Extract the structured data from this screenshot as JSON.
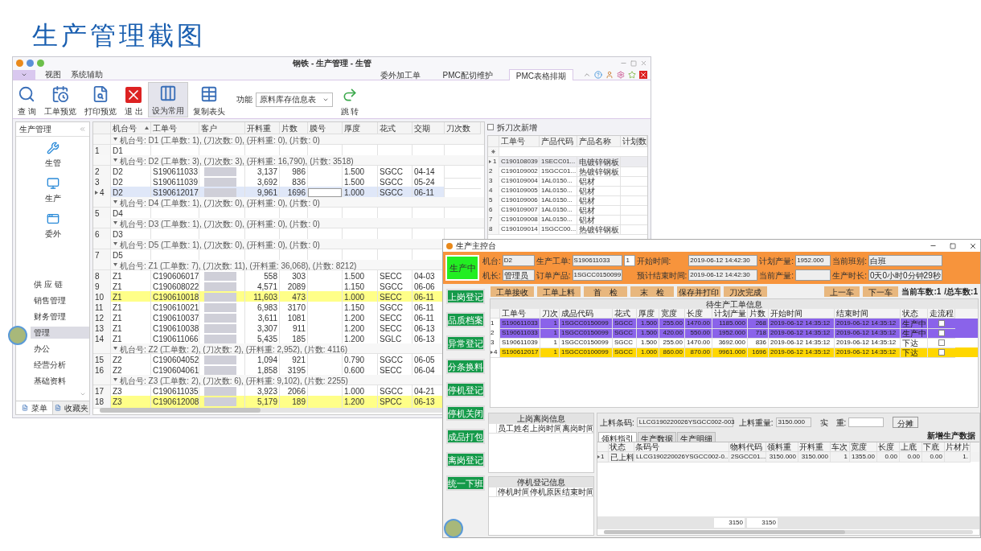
{
  "slide_title": "生产管理截图",
  "back_window": {
    "title": "钢铁 - 生产管理 - 生管",
    "menu": [
      "视图",
      "系统辅助"
    ],
    "ribbon_tabs": [
      {
        "label": "委外加工单",
        "selected": false
      },
      {
        "label": "PMC配切维护",
        "selected": false
      },
      {
        "label": "PMC表格排期",
        "selected": true
      }
    ],
    "toolbar": [
      {
        "label": "查 询",
        "selected": false
      },
      {
        "label": "工单预览",
        "selected": false
      },
      {
        "label": "打印预览",
        "selected": false
      },
      {
        "label": "退 出",
        "selected": false
      },
      {
        "label": "设为常用",
        "selected": true
      },
      {
        "label": "复制表头",
        "selected": false
      }
    ],
    "function_select": {
      "label": "功能",
      "value": "原料库存信息表"
    },
    "jump_button": "跳 转",
    "sidebar": {
      "title": "生产管理",
      "modules": [
        {
          "label": "生管"
        },
        {
          "label": "生产"
        },
        {
          "label": "委外"
        }
      ],
      "items": [
        {
          "label": "供 应 链",
          "selected": false
        },
        {
          "label": "销售管理",
          "selected": false
        },
        {
          "label": "财务管理",
          "selected": false
        },
        {
          "label": "管理",
          "selected": true
        },
        {
          "label": "办公",
          "selected": false
        },
        {
          "label": "经营分析",
          "selected": false
        },
        {
          "label": "基础资料",
          "selected": false
        }
      ],
      "tabs": [
        {
          "label": "菜单",
          "selected": true
        },
        {
          "label": "收藏夹",
          "selected": false
        }
      ]
    },
    "grid": {
      "columns": [
        "机台号",
        "工单号",
        "客户",
        "开料重",
        "片数",
        "膜号",
        "厚度",
        "花式",
        "交期",
        "刀次数"
      ],
      "rows": [
        {
          "kind": "group",
          "expanded": true,
          "text": "机台号: D1 (工单数: 1), (刀次数: 0), (开料重: 0), (片数: 0)"
        },
        {
          "kind": "row",
          "no": "1",
          "machine": "D1",
          "selected": false,
          "color": "#ffffff"
        },
        {
          "kind": "group",
          "expanded": true,
          "text": "机台号: D2 (工单数: 3), (刀次数: 3), (开料重: 16,790), (片数: 3518)"
        },
        {
          "kind": "row",
          "no": "2",
          "machine": "D2",
          "order": "S190611033",
          "customer_hidden": true,
          "weight": "3,137",
          "pieces": "986",
          "thickness": "1.500",
          "pattern": "SGCC",
          "due": "04-14",
          "selected": false,
          "color": "#ffffff"
        },
        {
          "kind": "row",
          "no": "3",
          "machine": "D2",
          "order": "S190611039",
          "customer_hidden": true,
          "weight": "3,692",
          "pieces": "836",
          "thickness": "1.500",
          "pattern": "SGCC",
          "due": "05-24",
          "selected": false,
          "color": "#ffffff"
        },
        {
          "kind": "row",
          "no": "4",
          "machine": "D2",
          "order": "S190612017",
          "customer_hidden": true,
          "weight": "9,961",
          "pieces": "1696",
          "thickness": "1.000",
          "pattern": "SGCC",
          "due": "06-11",
          "selected": true
        },
        {
          "kind": "group",
          "expanded": true,
          "text": "机台号: D4 (工单数: 1), (刀次数: 0), (开料重: 0), (片数: 0)"
        },
        {
          "kind": "row",
          "no": "5",
          "machine": "D4",
          "selected": false,
          "color": "#ffffff"
        },
        {
          "kind": "group",
          "expanded": true,
          "text": "机台号: D3 (工单数: 1), (刀次数: 0), (开料重: 0), (片数: 0)"
        },
        {
          "kind": "row",
          "no": "6",
          "machine": "D3",
          "selected": false,
          "color": "#ffffff"
        },
        {
          "kind": "group",
          "expanded": true,
          "text": "机台号: D5 (工单数: 1), (刀次数: 0), (开料重: 0), (片数: 0)"
        },
        {
          "kind": "row",
          "no": "7",
          "machine": "D5",
          "selected": false,
          "color": "#ffffff"
        },
        {
          "kind": "group",
          "expanded": true,
          "text": "机台号: Z1 (工单数: 7), (刀次数: 11), (开料重: 36,068), (片数: 8212)"
        },
        {
          "kind": "row",
          "no": "8",
          "machine": "Z1",
          "order": "C190606017",
          "customer_hidden": true,
          "weight": "558",
          "pieces": "303",
          "thickness": "1.500",
          "pattern": "SECC",
          "due": "04-03",
          "selected": false,
          "color": "#ffffff"
        },
        {
          "kind": "row",
          "no": "9",
          "machine": "Z1",
          "order": "C190608022",
          "customer_hidden": true,
          "weight": "4,571",
          "pieces": "2089",
          "thickness": "1.150",
          "pattern": "SGCC",
          "due": "06-06",
          "selected": false,
          "color": "#ffffff"
        },
        {
          "kind": "row",
          "no": "10",
          "machine": "Z1",
          "order": "C190610018",
          "customer_hidden": true,
          "weight": "11,603",
          "pieces": "473",
          "thickness": "1.000",
          "pattern": "SECC",
          "due": "06-11",
          "selected": false,
          "color": "#ffff88"
        },
        {
          "kind": "row",
          "no": "11",
          "machine": "Z1",
          "order": "C190610021",
          "customer_hidden": true,
          "weight": "6,983",
          "pieces": "3170",
          "thickness": "1.150",
          "pattern": "SGCC",
          "due": "06-11",
          "selected": false,
          "color": "#ffffff"
        },
        {
          "kind": "row",
          "no": "12",
          "machine": "Z1",
          "order": "C190610037",
          "customer_hidden": true,
          "weight": "3,611",
          "pieces": "1081",
          "thickness": "1.200",
          "pattern": "SECC",
          "due": "06-11",
          "selected": false,
          "color": "#ffffff"
        },
        {
          "kind": "row",
          "no": "13",
          "machine": "Z1",
          "order": "C190610038",
          "customer_hidden": true,
          "weight": "3,307",
          "pieces": "911",
          "thickness": "1.200",
          "pattern": "SECC",
          "due": "06-13",
          "selected": false,
          "color": "#ffffff"
        },
        {
          "kind": "row",
          "no": "14",
          "machine": "Z1",
          "order": "C190611066",
          "customer_hidden": true,
          "weight": "5,435",
          "pieces": "185",
          "thickness": "1.200",
          "pattern": "SGLC",
          "due": "06-13",
          "selected": false,
          "color": "#ffffff"
        },
        {
          "kind": "group",
          "expanded": true,
          "text": "机台号: Z2 (工单数: 2), (刀次数: 2), (开料重: 2,952), (片数: 4116)"
        },
        {
          "kind": "row",
          "no": "15",
          "machine": "Z2",
          "order": "C190604052",
          "customer_hidden": true,
          "weight": "1,094",
          "pieces": "921",
          "thickness": "0.790",
          "pattern": "SGCC",
          "due": "06-05",
          "selected": false,
          "color": "#ffffff"
        },
        {
          "kind": "row",
          "no": "16",
          "machine": "Z2",
          "order": "C190604061",
          "customer_hidden": true,
          "weight": "1,858",
          "pieces": "3195",
          "thickness": "0.600",
          "pattern": "SECC",
          "due": "06-04",
          "selected": false,
          "color": "#ffffff"
        },
        {
          "kind": "group",
          "expanded": true,
          "text": "机台号: Z3 (工单数: 2), (刀次数: 6), (开料重: 9,102), (片数: 2255)"
        },
        {
          "kind": "row",
          "no": "17",
          "machine": "Z3",
          "order": "C190611035",
          "customer_hidden": true,
          "weight": "3,923",
          "pieces": "2066",
          "thickness": "1.000",
          "pattern": "SGCC",
          "due": "04-21",
          "selected": false,
          "color": "#ffffff"
        },
        {
          "kind": "row",
          "no": "18",
          "machine": "Z3",
          "order": "C190612008",
          "customer_hidden": true,
          "weight": "5,179",
          "pieces": "189",
          "thickness": "1.200",
          "pattern": "SPCC",
          "due": "06-13",
          "selected": false,
          "color": "#ffff88"
        }
      ]
    },
    "side_grid": {
      "checkbox": {
        "label": "拆刀次新增",
        "checked": false
      },
      "columns": [
        "工单号",
        "产品代码",
        "产品名称",
        "计划数"
      ],
      "rows": [
        {
          "no": "1",
          "order": "C190108039",
          "code": "1SECC01...",
          "name": "电镀锌钢板",
          "selected": true
        },
        {
          "no": "2",
          "order": "C190109002",
          "code": "1SGCC01...",
          "name": "热镀锌钢板",
          "selected": false
        },
        {
          "no": "3",
          "order": "C190109004",
          "code": "1AL0150...",
          "name": "铝材",
          "selected": false
        },
        {
          "no": "4",
          "order": "C190109005",
          "code": "1AL0150...",
          "name": "铝材",
          "selected": false
        },
        {
          "no": "5",
          "order": "C190109006",
          "code": "1AL0150...",
          "name": "铝材",
          "selected": false
        },
        {
          "no": "6",
          "order": "C190109007",
          "code": "1AL0150...",
          "name": "铝材",
          "selected": false
        },
        {
          "no": "7",
          "order": "C190109008",
          "code": "1AL0150...",
          "name": "铝材",
          "selected": false
        },
        {
          "no": "8",
          "order": "C190109014",
          "code": "1SGCC00...",
          "name": "热镀锌钢板",
          "selected": false
        }
      ]
    }
  },
  "front_window": {
    "title": "生产主控台",
    "status": "生产中",
    "fields": [
      [
        {
          "label": "机台:",
          "value": "D2"
        },
        {
          "label": "生产工单:",
          "value": "S190611033",
          "extra": "1"
        },
        {
          "label": "开始时间:",
          "value": "2019-06-12 14:42:30"
        },
        {
          "label": "计划产量:",
          "value": "1952.000"
        },
        {
          "label": "当前班别:",
          "value": "白班"
        }
      ],
      [
        {
          "label": "机长:",
          "value": "管理员"
        },
        {
          "label": "订单产品:",
          "value": "1SGCC0150099"
        },
        {
          "label": "预计结束时间:",
          "value": "2019-06-12 14:42:30"
        },
        {
          "label": "当前产量:"
        },
        {
          "label": "生产时长:",
          "value": "0天0小时0分钟29秒"
        }
      ]
    ],
    "side_buttons": [
      "上岗登记",
      "品质档案",
      "异常登记",
      "分条换料",
      "停机登记",
      "停机关闭",
      "成品打包",
      "离岗登记",
      "统一下班"
    ],
    "actions": [
      "工单接收",
      "工单上料",
      "首　检",
      "末　检",
      "保存并打印",
      "刀次完成"
    ],
    "nav": [
      "上一车",
      "下一车"
    ],
    "car_count": [
      "当前车数:1",
      "/总车数:1"
    ],
    "orders": {
      "title": "待生产工单信息",
      "columns": [
        "工单号",
        "刀次",
        "成品代码",
        "花式",
        "厚度",
        "宽度",
        "长度",
        "计划产量",
        "片数",
        "开始时间",
        "结束时间",
        "状态",
        "走流程"
      ],
      "rows": [
        {
          "no": "1",
          "current": false,
          "color": "#8a63ea",
          "checked": false,
          "cells": [
            "S190611033",
            "1",
            "1SGCC0150099",
            "SGCC",
            "1.500",
            "255.00",
            "1470.00",
            "1185.000",
            "268",
            "2019-06-12 14:35:12",
            "2019-06-12 14:35:12",
            "生产中"
          ]
        },
        {
          "no": "2",
          "current": false,
          "color": "#8a63ea",
          "checked": false,
          "cells": [
            "S190611033",
            "1",
            "1SGCC0150099",
            "SGCC",
            "1.500",
            "420.00",
            "550.00",
            "1952.000",
            "718",
            "2019-06-12 14:35:12",
            "2019-06-12 14:35:12",
            "生产中"
          ]
        },
        {
          "no": "3",
          "current": false,
          "color": "#ffffff",
          "checked": false,
          "cells": [
            "S190611039",
            "1",
            "1SGCC0150099",
            "SGCC",
            "1.500",
            "255.00",
            "1470.00",
            "3692.000",
            "836",
            "2019-06-12 14:35:12",
            "2019-06-12 14:35:12",
            "下达"
          ]
        },
        {
          "no": "4",
          "current": true,
          "color": "#ffd700",
          "checked": false,
          "cells": [
            "S190612017",
            "1",
            "1SGCC0100099",
            "SGCC",
            "1.000",
            "860.00",
            "870.00",
            "9961.000",
            "1696",
            "2019-06-12 14:35:12",
            "2019-06-12 14:35:12",
            "下达"
          ]
        }
      ]
    },
    "shift_panel": {
      "title": "上岗离岗信息",
      "columns": [
        "员工姓名",
        "上岗时间",
        "离岗时间"
      ]
    },
    "stop_panel": {
      "title": "停机登记信息",
      "columns": [
        "停机时间",
        "停机原因",
        "结束时间"
      ]
    },
    "material": {
      "barcode_label": "上料条码:",
      "barcode": "LLCG190220026YSGCC002-003",
      "weight_label": "上料重量:",
      "weight": "3150.000",
      "actual_label": "实　重:",
      "button": "分摊",
      "tabs": [
        {
          "label": "领料指引",
          "selected": true
        },
        {
          "label": "生产数据",
          "selected": false
        },
        {
          "label": "生产明细",
          "selected": false
        }
      ],
      "new_label": "新增生产数据",
      "columns": [
        "状态",
        "条码号",
        "物料代码",
        "领料重",
        "开料重",
        "车次",
        "宽度",
        "长度",
        "上底",
        "下底",
        "片材片"
      ],
      "rows": [
        {
          "no": "1",
          "current": true,
          "cells": [
            "已上料",
            "LLCG190220026YSGCC002-0...",
            "2SGCC01...",
            "3150.000",
            "3150.000",
            "1",
            "1355.00",
            "0.00",
            "0.00",
            "0.00",
            "1."
          ]
        }
      ],
      "totals": [
        "3150",
        "3150"
      ]
    }
  }
}
